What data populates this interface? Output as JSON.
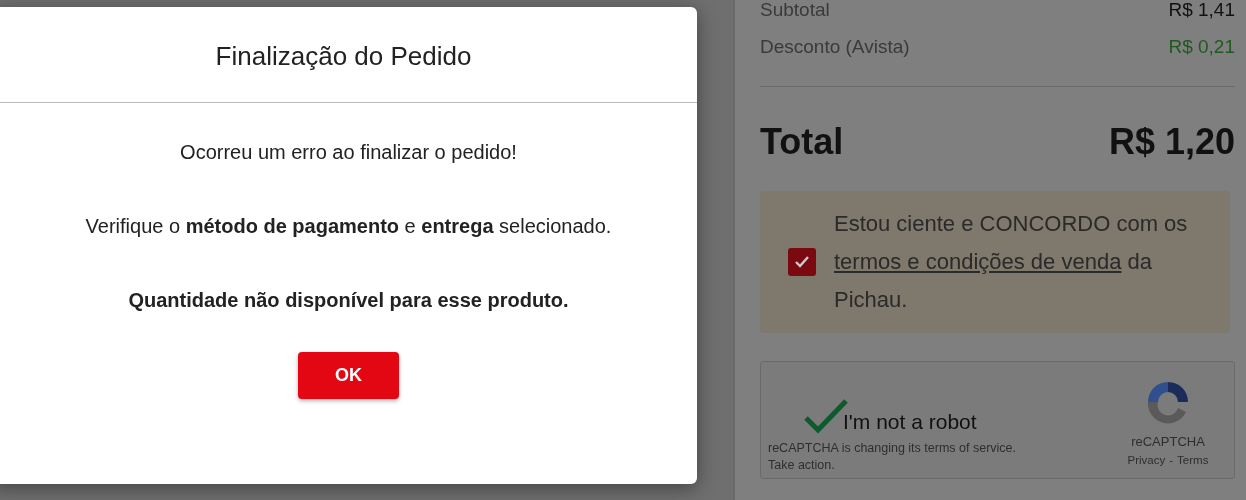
{
  "modal": {
    "title": "Finalização do Pedido",
    "paragraphs": [
      {
        "kind": "normal",
        "text": "Ocorreu um erro ao finalizar o pedido!"
      },
      {
        "kind": "normal",
        "text": "Verifique o **método de pagamento** e **entrega** selecionado."
      },
      {
        "kind": "error",
        "text": "Quantidade não disponível para esse produto."
      }
    ],
    "button": "OK"
  },
  "summary": {
    "rows": [
      {
        "kind": "normal",
        "label": "Subtotal",
        "value": "R$ 1,41"
      },
      {
        "kind": "discount",
        "label": "Desconto (Avista)",
        "value": "R$ 0,21"
      }
    ],
    "total": {
      "label": "Total",
      "value": "R$ 1,20"
    },
    "agree": {
      "checked": true,
      "before": "Estou ciente e CONCORDO com os",
      "link": "termos e condições de venda",
      "after": "da Pichau."
    },
    "recaptcha": {
      "checked": true,
      "label": "I'm not a robot",
      "notice": "reCAPTCHA is changing its terms of service.",
      "action": "Take action.",
      "brand": "reCAPTCHA",
      "links": [
        "Privacy",
        "Terms"
      ],
      "separator": "-"
    }
  }
}
